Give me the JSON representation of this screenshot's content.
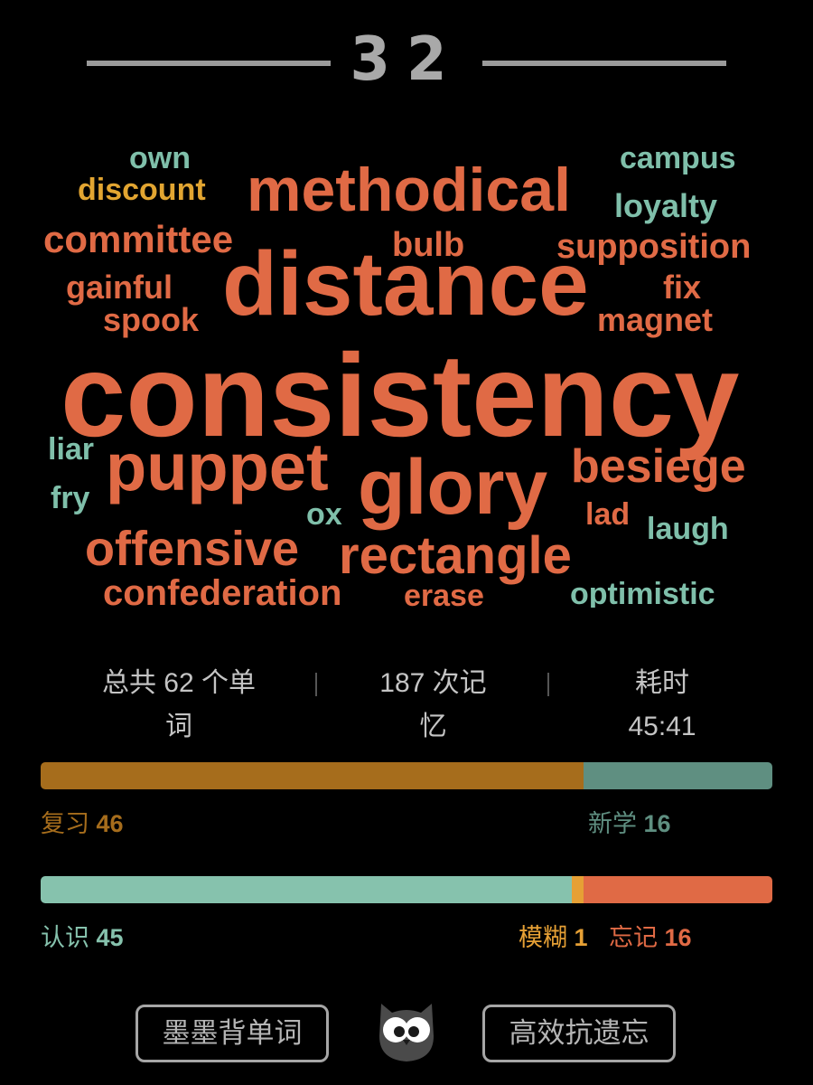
{
  "header": {
    "day_number": "32"
  },
  "word_cloud": [
    {
      "text": "own",
      "color": "#7fbfaa"
    },
    {
      "text": "campus",
      "color": "#7fbfaa"
    },
    {
      "text": "discount",
      "color": "#e2a531"
    },
    {
      "text": "methodical",
      "color": "#e06a45"
    },
    {
      "text": "loyalty",
      "color": "#7fbfaa"
    },
    {
      "text": "committee",
      "color": "#e06a45"
    },
    {
      "text": "bulb",
      "color": "#e06a45"
    },
    {
      "text": "supposition",
      "color": "#e06a45"
    },
    {
      "text": "gainful",
      "color": "#e06a45"
    },
    {
      "text": "distance",
      "color": "#e06a45"
    },
    {
      "text": "fix",
      "color": "#e06a45"
    },
    {
      "text": "spook",
      "color": "#e06a45"
    },
    {
      "text": "magnet",
      "color": "#e06a45"
    },
    {
      "text": "consistency",
      "color": "#e06a45"
    },
    {
      "text": "liar",
      "color": "#7fbfaa"
    },
    {
      "text": "puppet",
      "color": "#e06a45"
    },
    {
      "text": "glory",
      "color": "#e06a45"
    },
    {
      "text": "besiege",
      "color": "#e06a45"
    },
    {
      "text": "fry",
      "color": "#7fbfaa"
    },
    {
      "text": "ox",
      "color": "#7fbfaa"
    },
    {
      "text": "lad",
      "color": "#e06a45"
    },
    {
      "text": "laugh",
      "color": "#7fbfaa"
    },
    {
      "text": "offensive",
      "color": "#e06a45"
    },
    {
      "text": "rectangle",
      "color": "#e06a45"
    },
    {
      "text": "confederation",
      "color": "#e06a45"
    },
    {
      "text": "erase",
      "color": "#e06a45"
    },
    {
      "text": "optimistic",
      "color": "#7fbfaa"
    }
  ],
  "stats": {
    "total_line1": "总共 62 个单",
    "total_line2": "词",
    "reps_line1": "187 次记",
    "reps_line2": "忆",
    "time_line1": "耗时",
    "time_line2": "45:41",
    "separator": "|"
  },
  "bar_review_new": {
    "review_label": "复习",
    "review_count": "46",
    "review_color": "#a66d1c",
    "new_label": "新学",
    "new_count": "16",
    "new_color": "#5f8f81"
  },
  "bar_recall": {
    "known_label": "认识",
    "known_count": "45",
    "known_color": "#86c2ad",
    "vague_label": "模糊",
    "vague_count": "1",
    "vague_color": "#e6a035",
    "forgot_label": "忘记",
    "forgot_count": "16",
    "forgot_color": "#e06a45"
  },
  "footer": {
    "app_name": "墨墨背单词",
    "slogan": "高效抗遗忘",
    "logo_icon": "owl-icon"
  }
}
